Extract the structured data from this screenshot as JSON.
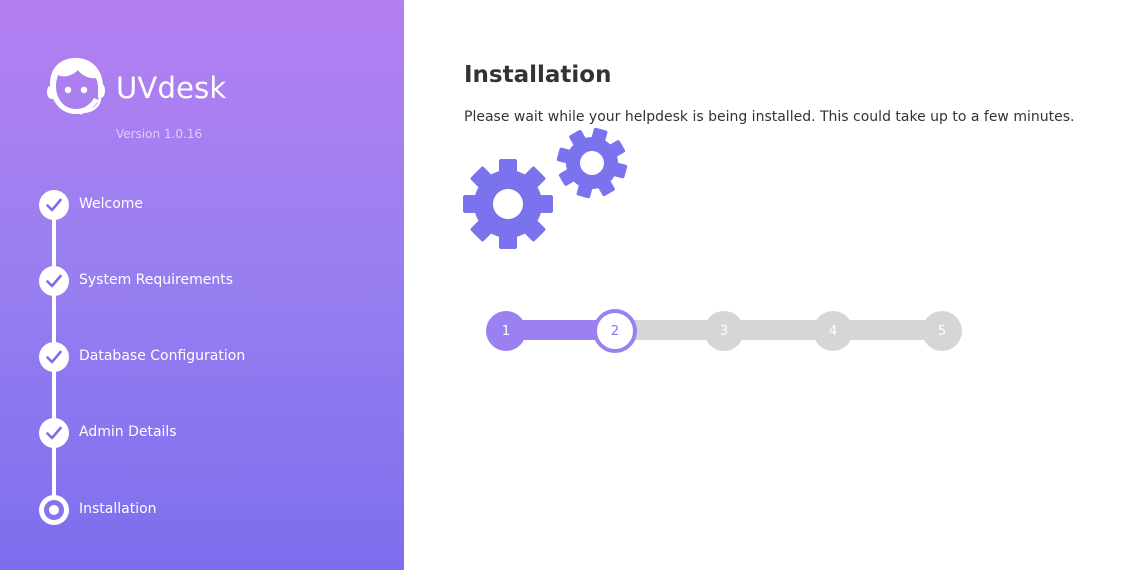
{
  "brand": {
    "name": "UVdesk",
    "version": "Version 1.0.16"
  },
  "steps": [
    {
      "label": "Welcome",
      "state": "done"
    },
    {
      "label": "System Requirements",
      "state": "done"
    },
    {
      "label": "Database Configuration",
      "state": "done"
    },
    {
      "label": "Admin Details",
      "state": "done"
    },
    {
      "label": "Installation",
      "state": "current"
    }
  ],
  "main": {
    "title": "Installation",
    "description": "Please wait while your helpdesk is being installed. This could take up to a few minutes."
  },
  "progress": {
    "nodes": [
      "1",
      "2",
      "3",
      "4",
      "5"
    ],
    "current_step": 2,
    "total_steps": 5
  },
  "colors": {
    "accent": "#9b80f1",
    "gear": "#7b73ee",
    "sidebar_top": "#b47ff1",
    "sidebar_bottom": "#7d6eee",
    "inactive": "#d6d6d6"
  }
}
